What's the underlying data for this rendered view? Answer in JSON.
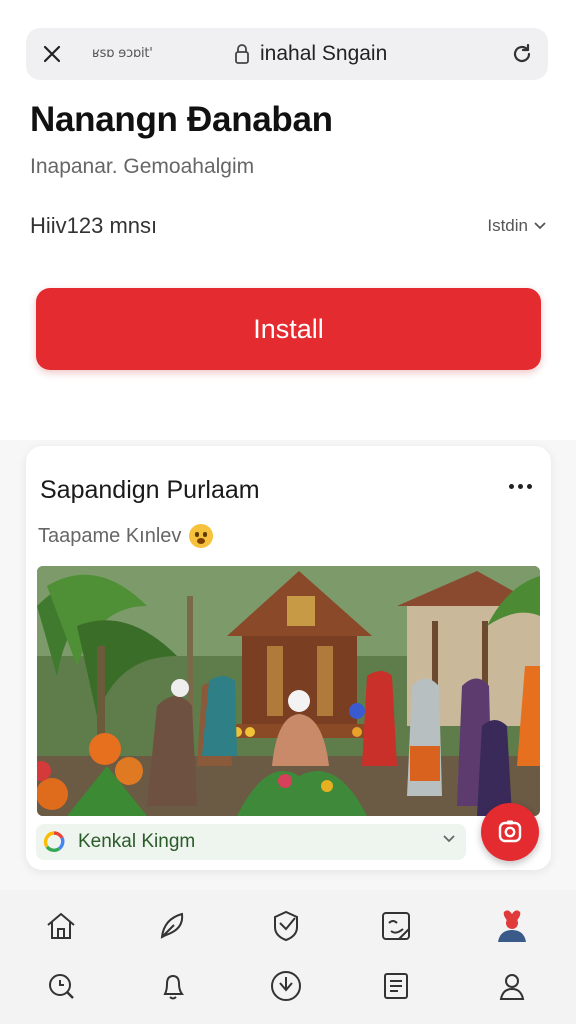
{
  "browser": {
    "url_sub": "ʁsɒ ɘɔɒit'",
    "url_title": "inahal Sngain",
    "icons": {
      "close": "close-icon",
      "lock": "lock-icon",
      "reload": "reload-icon"
    }
  },
  "app": {
    "title": "Nanangn Ɖanaban",
    "subtitle": "Inapanar. Gemoahalgim",
    "meta_left": "Hiiv123 mnsı",
    "meta_right": "Istdin",
    "install_label": "Install",
    "accent_color": "#e42b2f"
  },
  "card": {
    "title": "Sapandign Purlaam",
    "subtitle": "Taapame Kınlev",
    "tag_label": "Kenkal Kingm",
    "icons": {
      "more": "more-dots-icon",
      "emoji": "emoji-icon",
      "tag_logo": "g-logo-icon",
      "fab": "camera-icon"
    }
  },
  "bottom_nav": {
    "row1": [
      "home-icon",
      "feather-icon",
      "shield-icon",
      "sticker-icon",
      "heart-avatar-icon"
    ],
    "row2": [
      "search-icon",
      "bell-icon",
      "download-icon",
      "document-icon",
      "person-icon"
    ]
  }
}
